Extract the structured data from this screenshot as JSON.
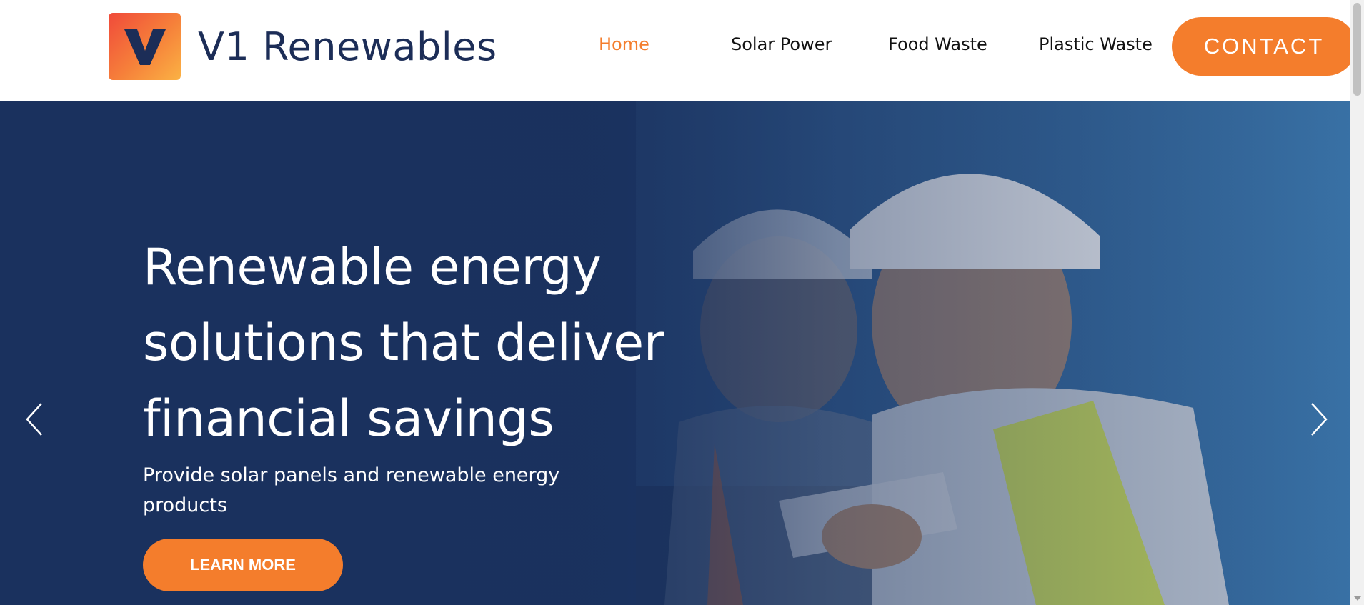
{
  "header": {
    "logo_letter": "V",
    "brand_name": "V1 Renewables",
    "nav": [
      {
        "label": "Home",
        "active": true
      },
      {
        "label": "Solar Power",
        "active": false
      },
      {
        "label": "Food Waste",
        "active": false
      },
      {
        "label": "Plastic Waste",
        "active": false
      }
    ],
    "contact_label": "CONTACT"
  },
  "hero": {
    "title_lines": [
      "Renewable energy",
      "solutions that deliver",
      "financial savings"
    ],
    "subtitle": "Provide solar panels and renewable energy products",
    "cta_label": "LEARN MORE",
    "prev_icon": "chevron-left-icon",
    "next_icon": "chevron-right-icon"
  },
  "colors": {
    "accent": "#f47d2c",
    "brand_navy": "#1c2d57",
    "hero_overlay": "#1a315e"
  }
}
